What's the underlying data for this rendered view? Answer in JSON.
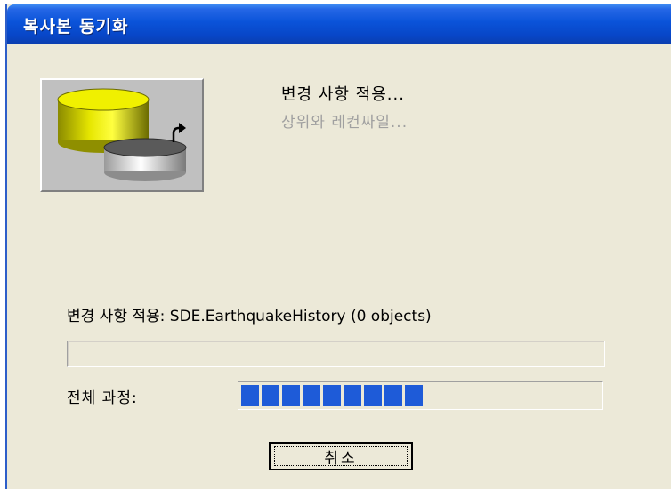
{
  "window": {
    "title": "복사본 동기화"
  },
  "status": {
    "title": "변경 사항 적용...",
    "subtitle": "상위와 레컨싸일..."
  },
  "progress": {
    "apply_label": "변경 사항 적용: SDE.EarthquakeHistory (0 objects)",
    "detail_fraction": 0,
    "overall_label": "전체 과정:",
    "overall_fraction": 0.52,
    "fill_color": "#1e5bd8"
  },
  "buttons": {
    "cancel_label": "취소"
  },
  "icons": {
    "dialog_icon": "replica-sync-database-icon"
  }
}
